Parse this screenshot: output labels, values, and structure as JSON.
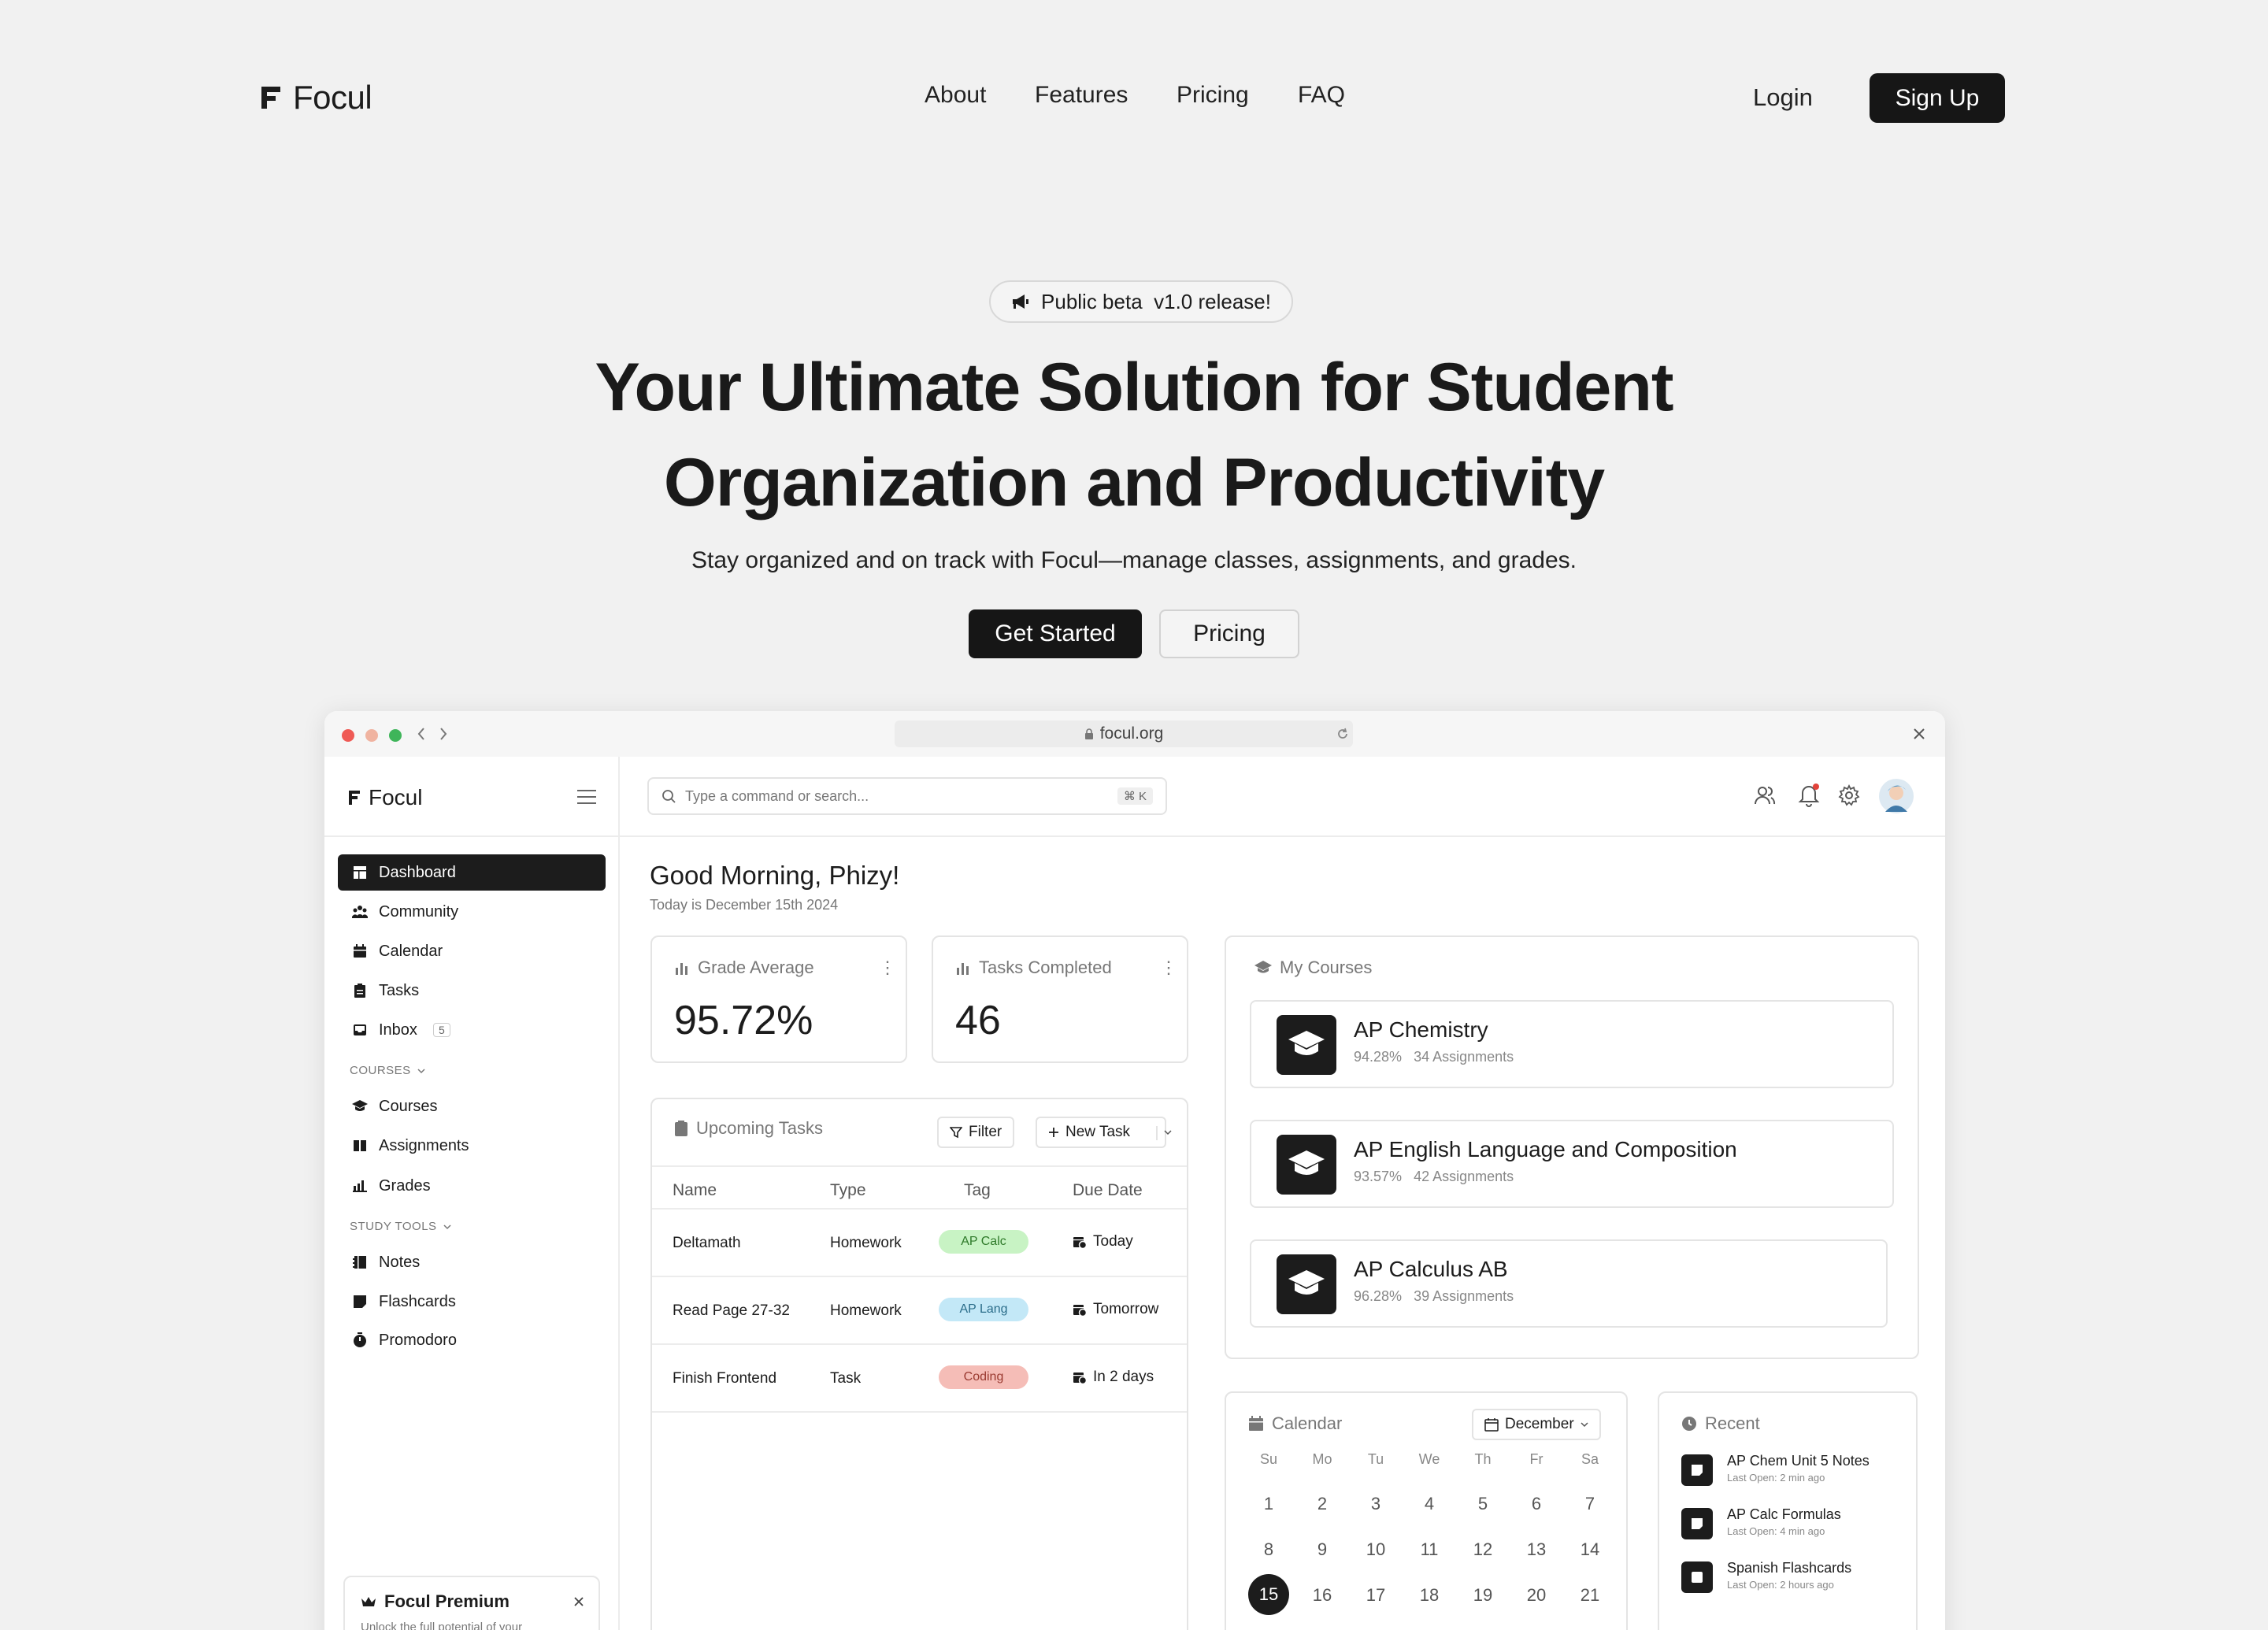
{
  "nav": {
    "brand": "Focul",
    "links": [
      "About",
      "Features",
      "Pricing",
      "FAQ"
    ],
    "login": "Login",
    "signup": "Sign Up"
  },
  "hero": {
    "badge": "Public beta  v1.0 release!",
    "title_line1": "Your Ultimate Solution for Student",
    "title_line2": "Organization and Productivity",
    "subtitle": "Stay organized and on track with Focul—manage classes, assignments, and grades.",
    "primary_cta": "Get Started",
    "secondary_cta": "Pricing"
  },
  "browser": {
    "url": "focul.org"
  },
  "app": {
    "brand": "Focul",
    "search_placeholder": "Type a command or search...",
    "search_shortcut": "⌘ K",
    "sidebar": {
      "items": [
        {
          "label": "Dashboard",
          "icon": "dashboard-icon",
          "active": true
        },
        {
          "label": "Community",
          "icon": "community-icon"
        },
        {
          "label": "Calendar",
          "icon": "calendar-icon"
        },
        {
          "label": "Tasks",
          "icon": "tasks-icon"
        },
        {
          "label": "Inbox",
          "icon": "inbox-icon",
          "count": "5"
        }
      ],
      "courses_section": "COURSES",
      "course_items": [
        {
          "label": "Courses",
          "icon": "graduation-cap-icon"
        },
        {
          "label": "Assignments",
          "icon": "book-icon"
        },
        {
          "label": "Grades",
          "icon": "grades-icon"
        }
      ],
      "study_section": "STUDY TOOLS",
      "study_items": [
        {
          "label": "Notes",
          "icon": "notes-icon"
        },
        {
          "label": "Flashcards",
          "icon": "flashcards-icon"
        },
        {
          "label": "Promodoro",
          "icon": "timer-icon"
        }
      ],
      "premium": {
        "title": "Focul Premium",
        "text": "Unlock the full potential of your academic journey with Focul Premium. Take advantage of"
      }
    },
    "greeting": "Good Morning, Phizy!",
    "date_line": "Today is December 15th 2024",
    "stats": [
      {
        "label": "Grade Average",
        "value": "95.72%"
      },
      {
        "label": "Tasks Completed",
        "value": "46"
      }
    ],
    "tasks": {
      "title": "Upcoming Tasks",
      "filter": "Filter",
      "new_task": "New Task",
      "columns": [
        "Name",
        "Type",
        "Tag",
        "Due Date"
      ],
      "rows": [
        {
          "name": "Deltamath",
          "type": "Homework",
          "tag": "AP Calc",
          "tag_bg": "#c8f3c4",
          "tag_fg": "#2f7a2a",
          "due": "Today"
        },
        {
          "name": "Read Page 27-32",
          "type": "Homework",
          "tag": "AP Lang",
          "tag_bg": "#c3e8f7",
          "tag_fg": "#2b6d8a",
          "due": "Tomorrow"
        },
        {
          "name": "Finish Frontend",
          "type": "Task",
          "tag": "Coding",
          "tag_bg": "#f5bdb7",
          "tag_fg": "#9a3a30",
          "due": "In 2 days"
        }
      ]
    },
    "courses": {
      "title": "My Courses",
      "items": [
        {
          "name": "AP Chemistry",
          "grade": "94.28%",
          "assignments": "34 Assignments"
        },
        {
          "name": "AP English Language and Composition",
          "grade": "93.57%",
          "assignments": "42 Assignments"
        },
        {
          "name": "AP Calculus AB",
          "grade": "96.28%",
          "assignments": "39 Assignments"
        }
      ]
    },
    "calendar": {
      "title": "Calendar",
      "month": "December",
      "weekdays": [
        "Su",
        "Mo",
        "Tu",
        "We",
        "Th",
        "Fr",
        "Sa"
      ],
      "weeks": [
        [
          "1",
          "2",
          "3",
          "4",
          "5",
          "6",
          "7"
        ],
        [
          "8",
          "9",
          "10",
          "11",
          "12",
          "13",
          "14"
        ],
        [
          "15",
          "16",
          "17",
          "18",
          "19",
          "20",
          "21"
        ]
      ],
      "today": "15"
    },
    "recent": {
      "title": "Recent",
      "items": [
        {
          "name": "AP Chem Unit 5 Notes",
          "meta": "Last Open: 2 min ago"
        },
        {
          "name": "AP Calc Formulas",
          "meta": "Last Open: 4 min ago"
        },
        {
          "name": "Spanish Flashcards",
          "meta": "Last Open: 2 hours ago"
        }
      ]
    }
  }
}
